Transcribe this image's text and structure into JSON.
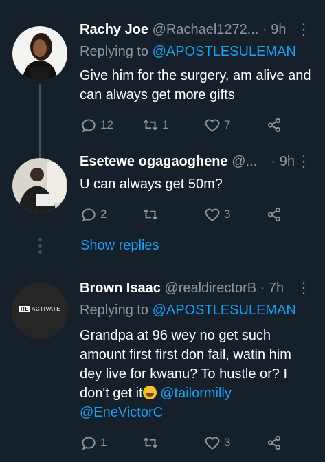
{
  "tweets": [
    {
      "name": "Rachy Joe",
      "handle": "@Rachael1272...",
      "time": "· 9h",
      "replying_prefix": "Replying to ",
      "replying_to": "@APOSTLESULEMAN",
      "text": "Give him for the surgery, am alive and can always get more gifts",
      "replies": "12",
      "retweets": "1",
      "likes": "7"
    },
    {
      "name": "Esetewe ogagaoghene",
      "handle": "@...",
      "time": "· 9h",
      "text": "U can always get 50m?",
      "replies": "2",
      "retweets": "",
      "likes": "3"
    },
    {
      "name": "Brown Isaac",
      "handle": "@realdirectorB",
      "time": "· 7h",
      "replying_prefix": "Replying to ",
      "replying_to": "@APOSTLESULEMAN",
      "text_main": "Grandpa at 96 wey no get such amount first first don fail, watin him dey live for kwanu? To hustle or? I don't get it",
      "mention1": "@tailormilly",
      "mention2": "@EneVictorC",
      "replies": "1",
      "retweets": "",
      "likes": "3",
      "avatar_brand_prefix": "RE",
      "avatar_brand_suffix": "ACTIVATE"
    }
  ],
  "show_replies_label": "Show replies",
  "more_glyph": "⋮",
  "colors": {
    "background": "#15202b",
    "accent": "#1da1f2",
    "muted": "#8899a6",
    "divider": "#38444d"
  },
  "icons": [
    "reply-icon",
    "retweet-icon",
    "like-icon",
    "share-icon",
    "more-icon"
  ]
}
